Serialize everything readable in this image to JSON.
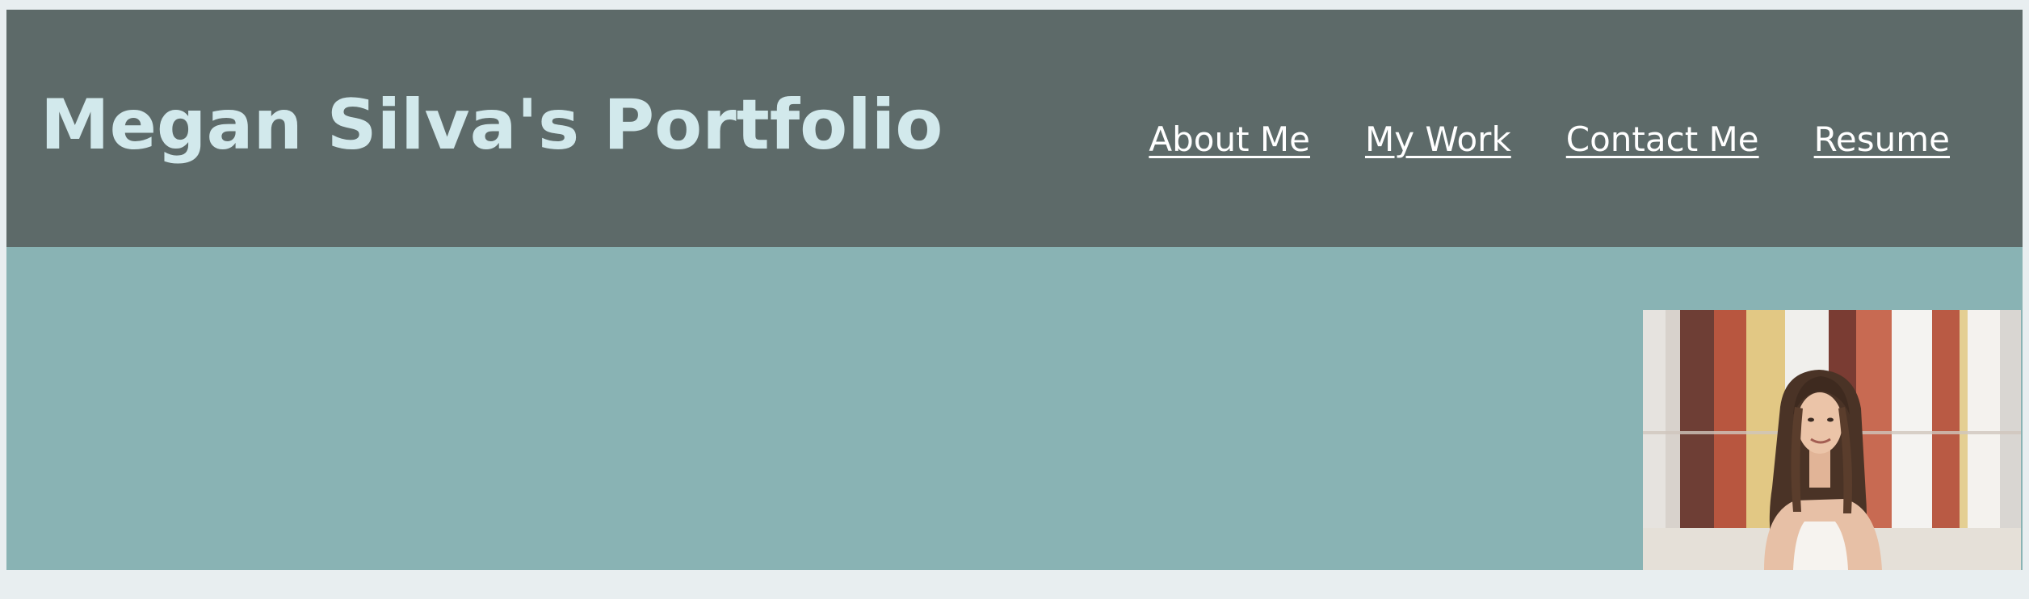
{
  "header": {
    "title": "Megan Silva's Portfolio",
    "background": "#5d6a69",
    "title_color": "#d2e9ec"
  },
  "nav": {
    "items": [
      {
        "label": "About Me"
      },
      {
        "label": "My Work"
      },
      {
        "label": "Contact Me"
      },
      {
        "label": "Resume"
      }
    ],
    "link_color": "#ffffff"
  },
  "hero": {
    "background": "#89b3b4",
    "photo_subject": "portrait-photo"
  },
  "page_background": "#e8eef0"
}
